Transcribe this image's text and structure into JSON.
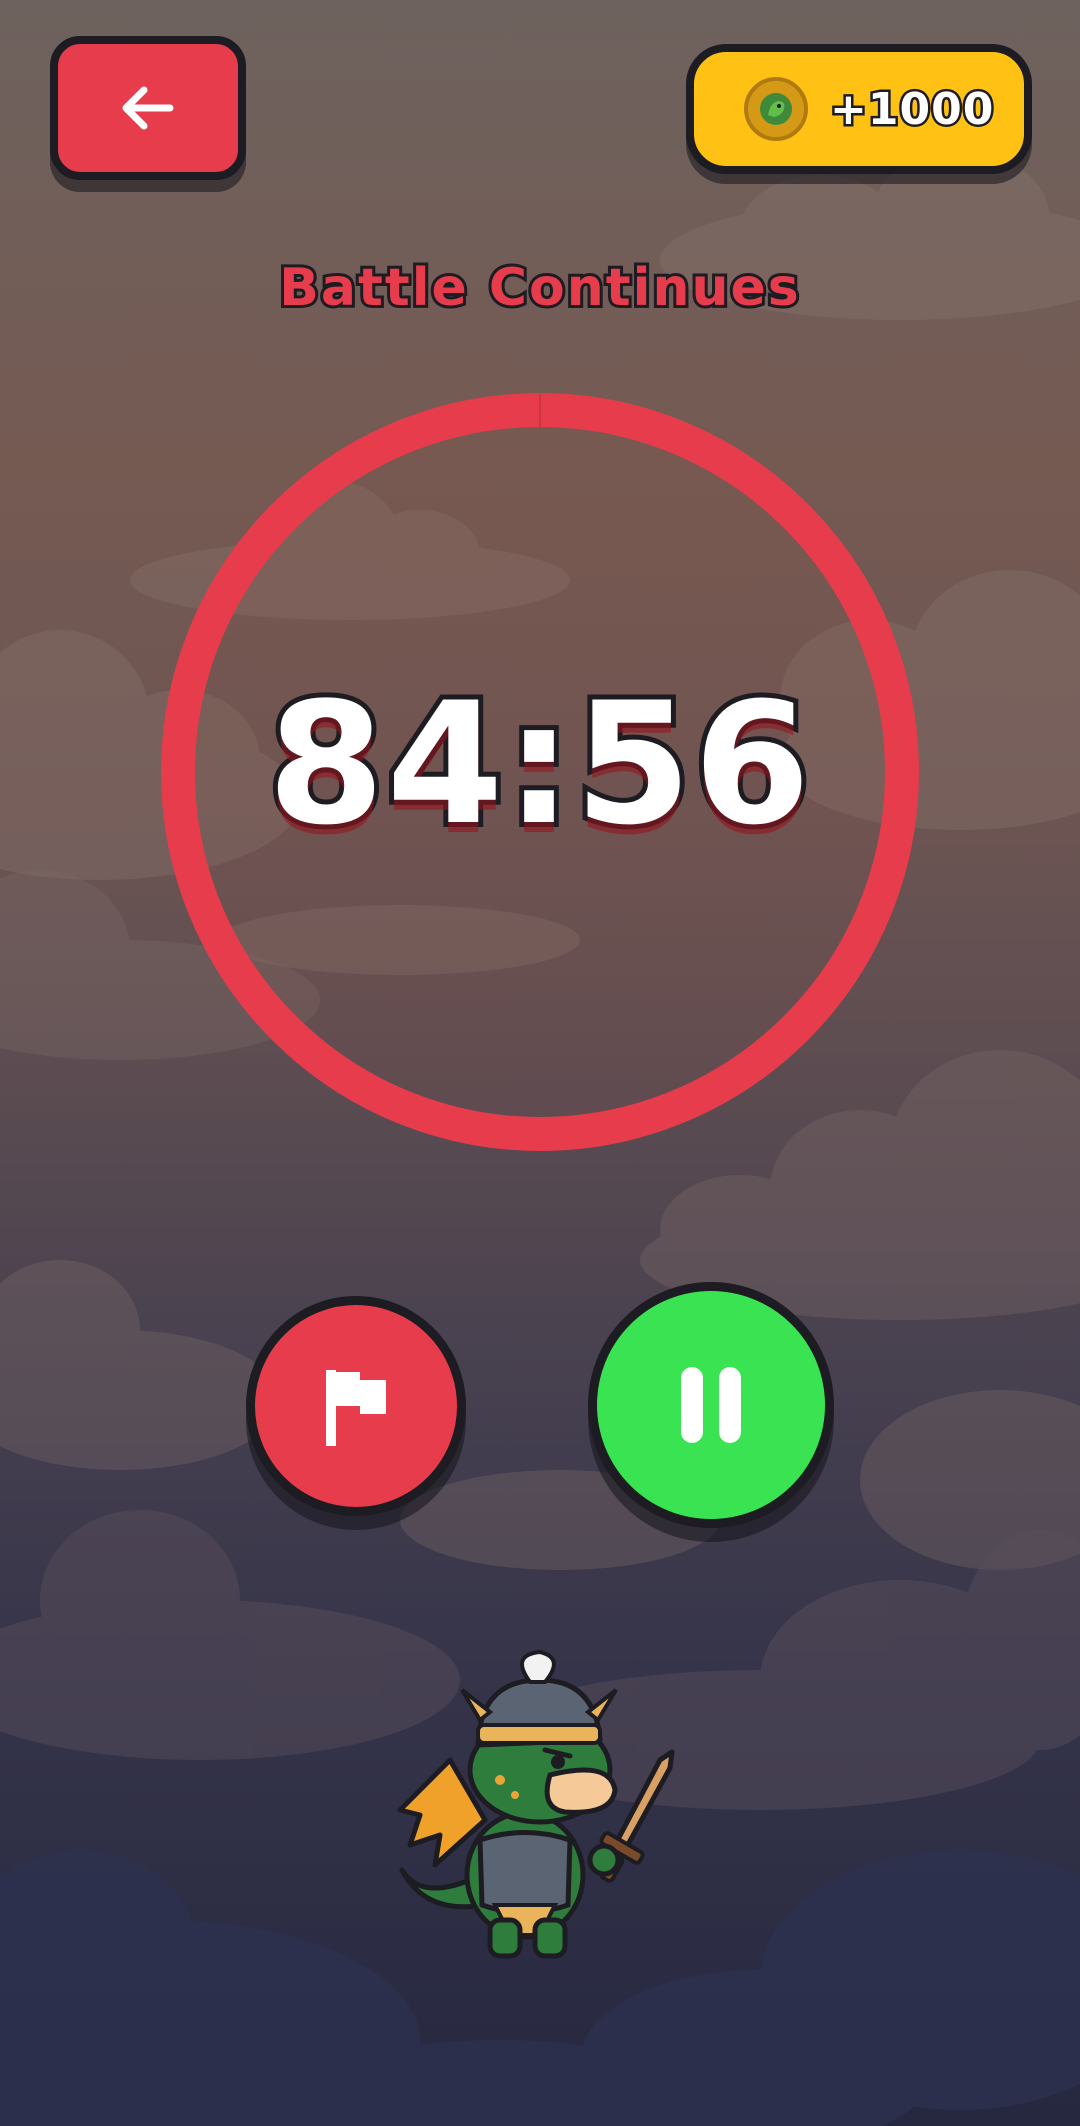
{
  "header": {
    "back_icon": "arrow-left-icon",
    "coins": {
      "icon": "dragon-coin-icon",
      "label": "+1000"
    }
  },
  "main": {
    "title": "Battle Continues",
    "timer": "84:56",
    "timer_progress": 1.0
  },
  "controls": {
    "flag_icon": "flag-icon",
    "pause_icon": "pause-icon"
  },
  "mascot": {
    "icon": "knight-dragon-mascot"
  },
  "colors": {
    "accent_red": "#e63c4b",
    "coin_yellow": "#ffc214",
    "play_green": "#3ae352",
    "outline": "#1c1c22"
  }
}
